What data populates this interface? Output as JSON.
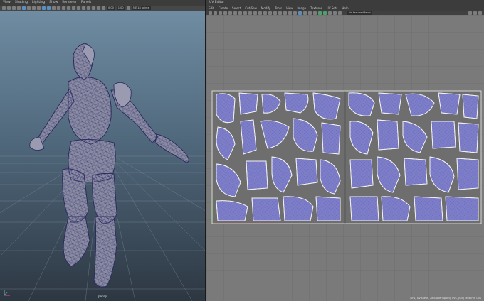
{
  "left_panel": {
    "menu": [
      "View",
      "Shading",
      "Lighting",
      "Show",
      "Renderer",
      "Panels"
    ],
    "toolbar_fields": [
      "0.00",
      "1.00"
    ],
    "poly_count": "58518 points",
    "camera_label": "persp"
  },
  "right_panel": {
    "title": "UV Editor",
    "menu": [
      "Edit",
      "Create",
      "Select",
      "Cut/Sew",
      "Modify",
      "Tools",
      "View",
      "Image",
      "Textures",
      "UV Sets",
      "Help"
    ],
    "texture_label": "No textured faces",
    "readout": "(0%) UV shells, 28% overlapping UVs, (0%) textured UVs"
  },
  "colors": {
    "menu_bg": "#3c3c3c",
    "viewport_top": "#6f8ca2",
    "viewport_bottom": "#2d3742",
    "uv_grid_bg": "#7a7a7a",
    "uv_tile_bg": "#6e6e6e",
    "uv_wire": "#6a6ad8",
    "mesh_fill": "#8a8ba0",
    "mesh_wire": "#3a3a7a"
  }
}
